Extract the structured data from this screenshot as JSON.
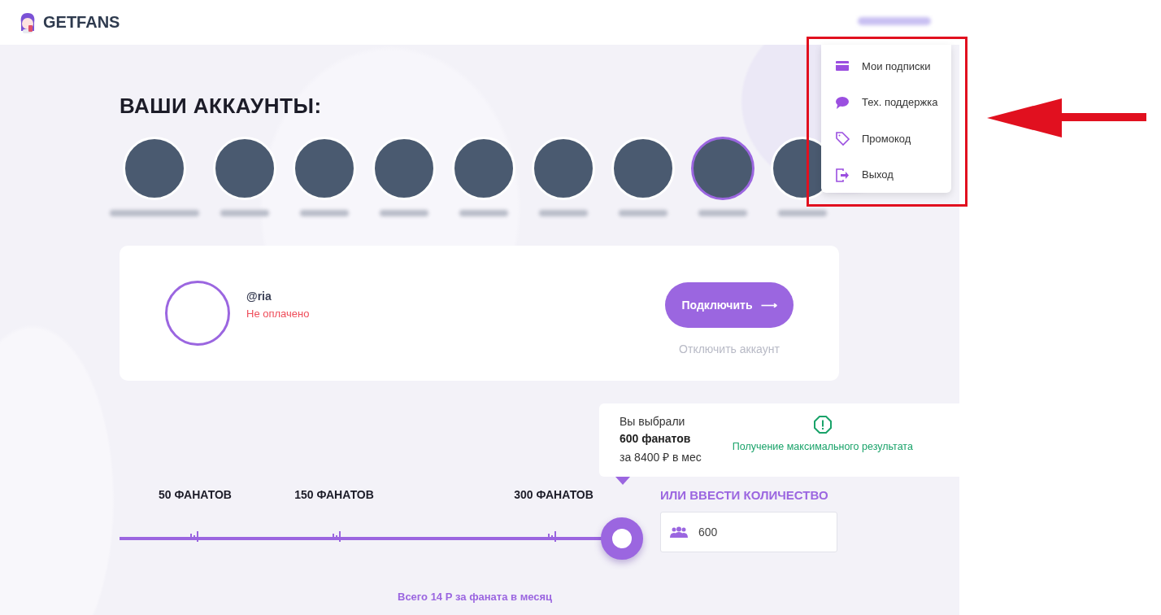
{
  "header": {
    "logo": "GETFANS"
  },
  "title": "ВАШИ АККАУНТЫ:",
  "accounts": [
    {
      "selected": false
    },
    {
      "selected": false
    },
    {
      "selected": false
    },
    {
      "selected": false
    },
    {
      "selected": false
    },
    {
      "selected": false
    },
    {
      "selected": false
    },
    {
      "selected": true
    },
    {
      "selected": false
    }
  ],
  "account_card": {
    "name": "@ria",
    "status": "Не оплачено",
    "connect_button": {
      "label": "Подключить",
      "arrow": "⟶"
    },
    "disconnect_link": "Отключить аккаунт"
  },
  "menu": {
    "items": [
      {
        "kind": "card",
        "label": "Мои подписки"
      },
      {
        "kind": "chat",
        "label": "Тех. поддержка"
      },
      {
        "kind": "tag",
        "label": "Промокод"
      },
      {
        "kind": "exit",
        "label": "Выход"
      }
    ]
  },
  "selection": {
    "line1": "Вы выбрали",
    "amount": "600 фанатов",
    "price": "за 8400 ₽ в мес",
    "note": "Получение максимального результата"
  },
  "slider": {
    "marks": [
      "50 ФАНАТОВ",
      "150 ФАНАТОВ",
      "300 ФАНАТОВ"
    ],
    "level": 1,
    "caption": "Всего 14 Р за фаната в месяц"
  },
  "custom_amount": {
    "label": "ИЛИ ВВЕСТИ КОЛИЧЕСТВО",
    "value": "600"
  }
}
